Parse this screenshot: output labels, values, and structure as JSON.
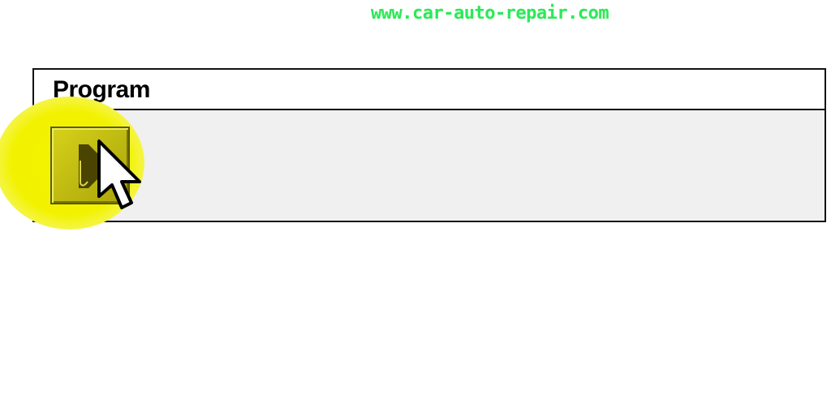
{
  "watermark": "www.car-auto-repair.com",
  "panel": {
    "title": "Program"
  },
  "program_button": {
    "icon": "play-icon"
  },
  "cursor": {
    "icon": "mouse-pointer-icon"
  },
  "colors": {
    "watermark": "#2ee85a",
    "highlight": "#f4f400",
    "button": "#c2bd12",
    "panel_body": "#f0f0f0",
    "border": "#111111"
  }
}
